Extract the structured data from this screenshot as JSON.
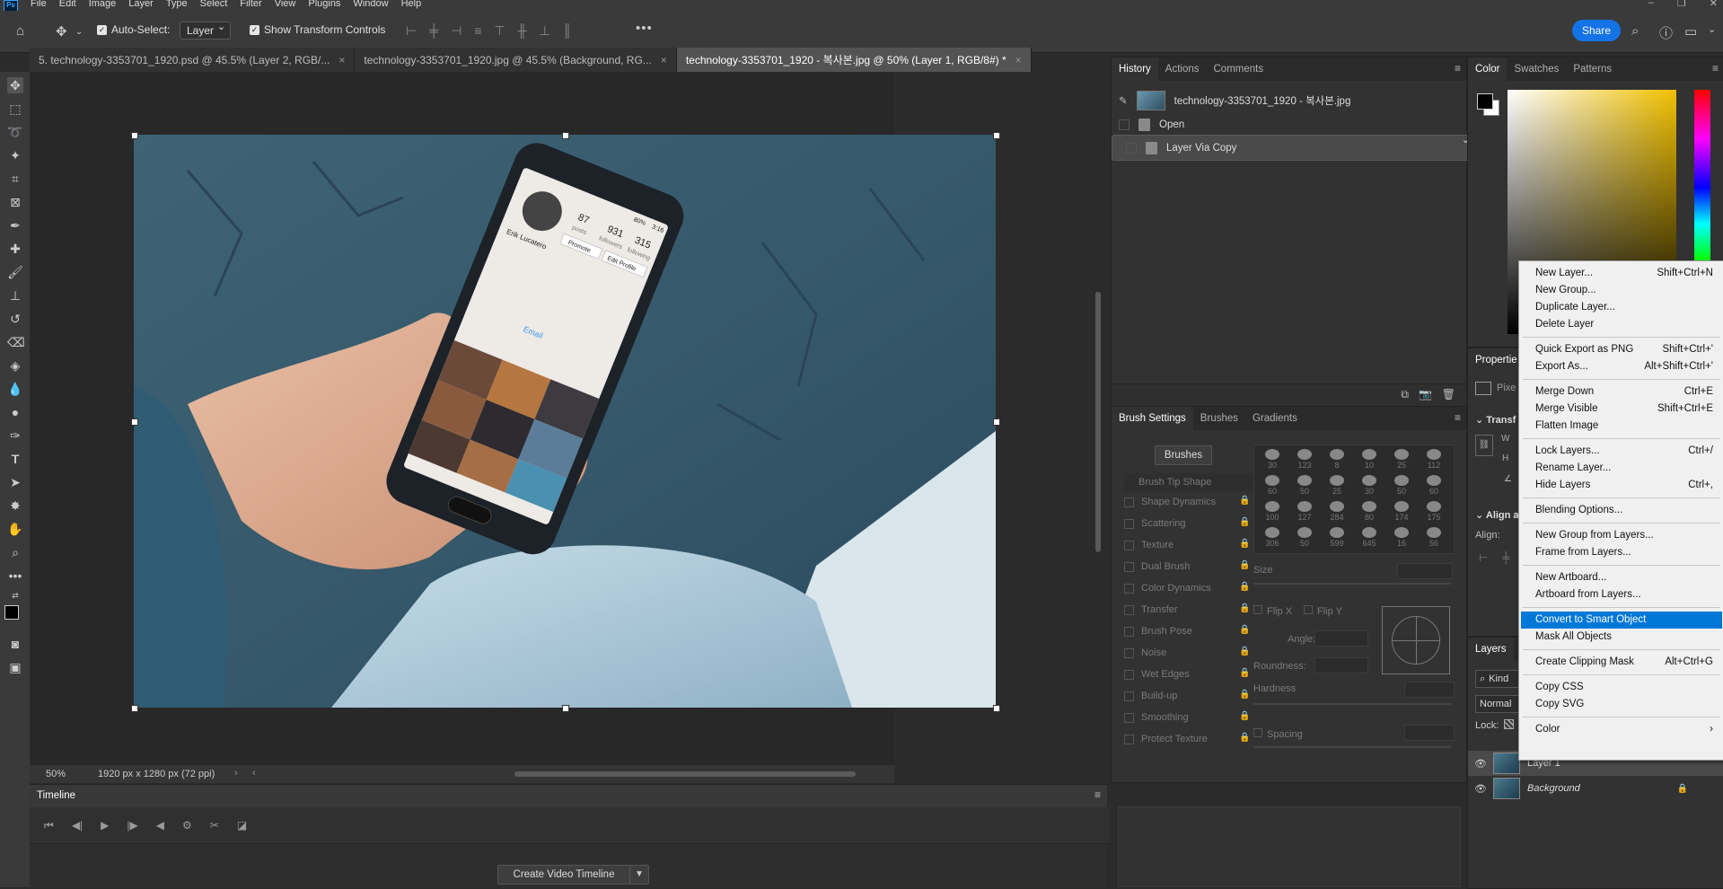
{
  "menubar": {
    "logo": "Ps",
    "items": [
      "File",
      "Edit",
      "Image",
      "Layer",
      "Type",
      "Select",
      "Filter",
      "View",
      "Plugins",
      "Window",
      "Help"
    ]
  },
  "options": {
    "auto_select_label": "Auto-Select:",
    "auto_select_value": "Layer",
    "show_transform_label": "Show Transform Controls",
    "more": "•••",
    "share": "Share"
  },
  "doc_tabs": [
    {
      "label": "5. technology-3353701_1920.psd @ 45.5% (Layer 2, RGB/...",
      "close": "×"
    },
    {
      "label": "technology-3353701_1920.jpg @ 45.5% (Background, RG...",
      "close": "×"
    },
    {
      "label": "technology-3353701_1920 - 복사본.jpg @ 50% (Layer 1, RGB/8#) *",
      "close": "×"
    }
  ],
  "status": {
    "zoom": "50%",
    "size": "1920 px x 1280 px (72 ppi)"
  },
  "phone_screen": {
    "posts": "87",
    "posts_label": "posts",
    "followers": "931",
    "followers_label": "followers",
    "following": "315",
    "following_label": "following",
    "promote": "Promote",
    "edit_profile": "Edit Profile",
    "name": "Erik Lucatero",
    "email": "Email",
    "status_time": "3:16",
    "battery": "80%"
  },
  "timeline": {
    "title": "Timeline",
    "create_button": "Create Video Timeline"
  },
  "history": {
    "tabs": [
      "History",
      "Actions",
      "Comments"
    ],
    "snapshot": "technology-3353701_1920 - 복사본.jpg",
    "steps": [
      "Open",
      "Layer Via Copy"
    ]
  },
  "brush": {
    "tabs": [
      "Brush Settings",
      "Brushes",
      "Gradients"
    ],
    "brushes_button": "Brushes",
    "options": [
      "Brush Tip Shape",
      "Shape Dynamics",
      "Scattering",
      "Texture",
      "Dual Brush",
      "Color Dynamics",
      "Transfer",
      "Brush Pose",
      "Noise",
      "Wet Edges",
      "Build-up",
      "Smoothing",
      "Protect Texture"
    ],
    "tip_sizes": [
      "30",
      "123",
      "8",
      "10",
      "25",
      "112",
      "60",
      "50",
      "25",
      "30",
      "50",
      "60",
      "100",
      "127",
      "284",
      "80",
      "174",
      "175",
      "306",
      "50",
      "599",
      "645",
      "16",
      "56"
    ],
    "size_label": "Size",
    "flip_x": "Flip X",
    "flip_y": "Flip Y",
    "angle_label": "Angle:",
    "roundness_label": "Roundness:",
    "hardness_label": "Hardness",
    "spacing_label": "Spacing"
  },
  "color_panel": {
    "tabs": [
      "Color",
      "Swatches",
      "Patterns"
    ]
  },
  "properties": {
    "tab": "Propertie",
    "pixel": "Pixe",
    "transform": "Transf",
    "w": "W",
    "h": "H",
    "align": "Align a",
    "align_label": "Align:"
  },
  "layers": {
    "tab": "Layers",
    "kind": "Kind",
    "blend": "Normal",
    "lock": "Lock:",
    "items": [
      {
        "name": "Layer 1"
      },
      {
        "name": "Background"
      }
    ]
  },
  "context_menu": {
    "items": [
      {
        "label": "New Layer...",
        "shortcut": "Shift+Ctrl+N"
      },
      {
        "label": "New Group...",
        "shortcut": ""
      },
      {
        "label": "Duplicate Layer...",
        "shortcut": ""
      },
      {
        "label": "Delete Layer",
        "shortcut": ""
      },
      {
        "label": "Quick Export as PNG",
        "shortcut": "Shift+Ctrl+'"
      },
      {
        "label": "Export As...",
        "shortcut": "Alt+Shift+Ctrl+'"
      },
      {
        "label": "Merge Down",
        "shortcut": "Ctrl+E"
      },
      {
        "label": "Merge Visible",
        "shortcut": "Shift+Ctrl+E"
      },
      {
        "label": "Flatten Image",
        "shortcut": ""
      },
      {
        "label": "Lock Layers...",
        "shortcut": "Ctrl+/"
      },
      {
        "label": "Rename Layer...",
        "shortcut": ""
      },
      {
        "label": "Hide Layers",
        "shortcut": "Ctrl+,"
      },
      {
        "label": "Blending Options...",
        "shortcut": ""
      },
      {
        "label": "New Group from Layers...",
        "shortcut": ""
      },
      {
        "label": "Frame from Layers...",
        "shortcut": ""
      },
      {
        "label": "New Artboard...",
        "shortcut": ""
      },
      {
        "label": "Artboard from Layers...",
        "shortcut": ""
      },
      {
        "label": "Convert to Smart Object",
        "shortcut": ""
      },
      {
        "label": "Mask All Objects",
        "shortcut": ""
      },
      {
        "label": "Create Clipping Mask",
        "shortcut": "Alt+Ctrl+G"
      },
      {
        "label": "Copy CSS",
        "shortcut": ""
      },
      {
        "label": "Copy SVG",
        "shortcut": ""
      },
      {
        "label": "Color",
        "shortcut": "›"
      }
    ]
  },
  "colors": {
    "accent": "#1473e6",
    "menu_highlight": "#0078d7",
    "panel_bg": "#323232",
    "app_bg": "#2b2b2b"
  }
}
